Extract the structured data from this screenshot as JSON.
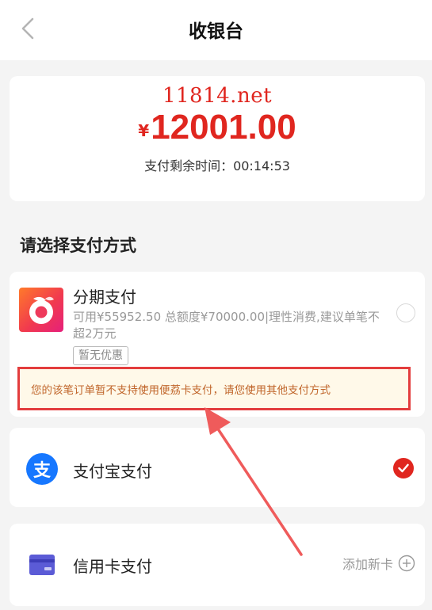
{
  "header": {
    "title": "收银台"
  },
  "amount": {
    "watermark": "11814.net",
    "currency": "¥",
    "value": "12001.00",
    "timer": "支付剩余时间：00:14:53"
  },
  "section_title": "请选择支付方式",
  "installment": {
    "name": "分期支付",
    "desc": "可用¥55952.50 总额度¥70000.00|理性消费,建议单笔不超2万元",
    "tag": "暂无优惠",
    "notice": "您的该笔订单暂不支持使用便荔卡支付，请您使用其他支付方式",
    "selected": false
  },
  "alipay": {
    "label": "支付宝支付",
    "icon_char": "支",
    "selected": true
  },
  "credit": {
    "label": "信用卡支付",
    "add_label": "添加新卡"
  },
  "colors": {
    "accent": "#e0261f",
    "notice_border": "#e33d3d",
    "alipay_blue": "#1677ff"
  }
}
